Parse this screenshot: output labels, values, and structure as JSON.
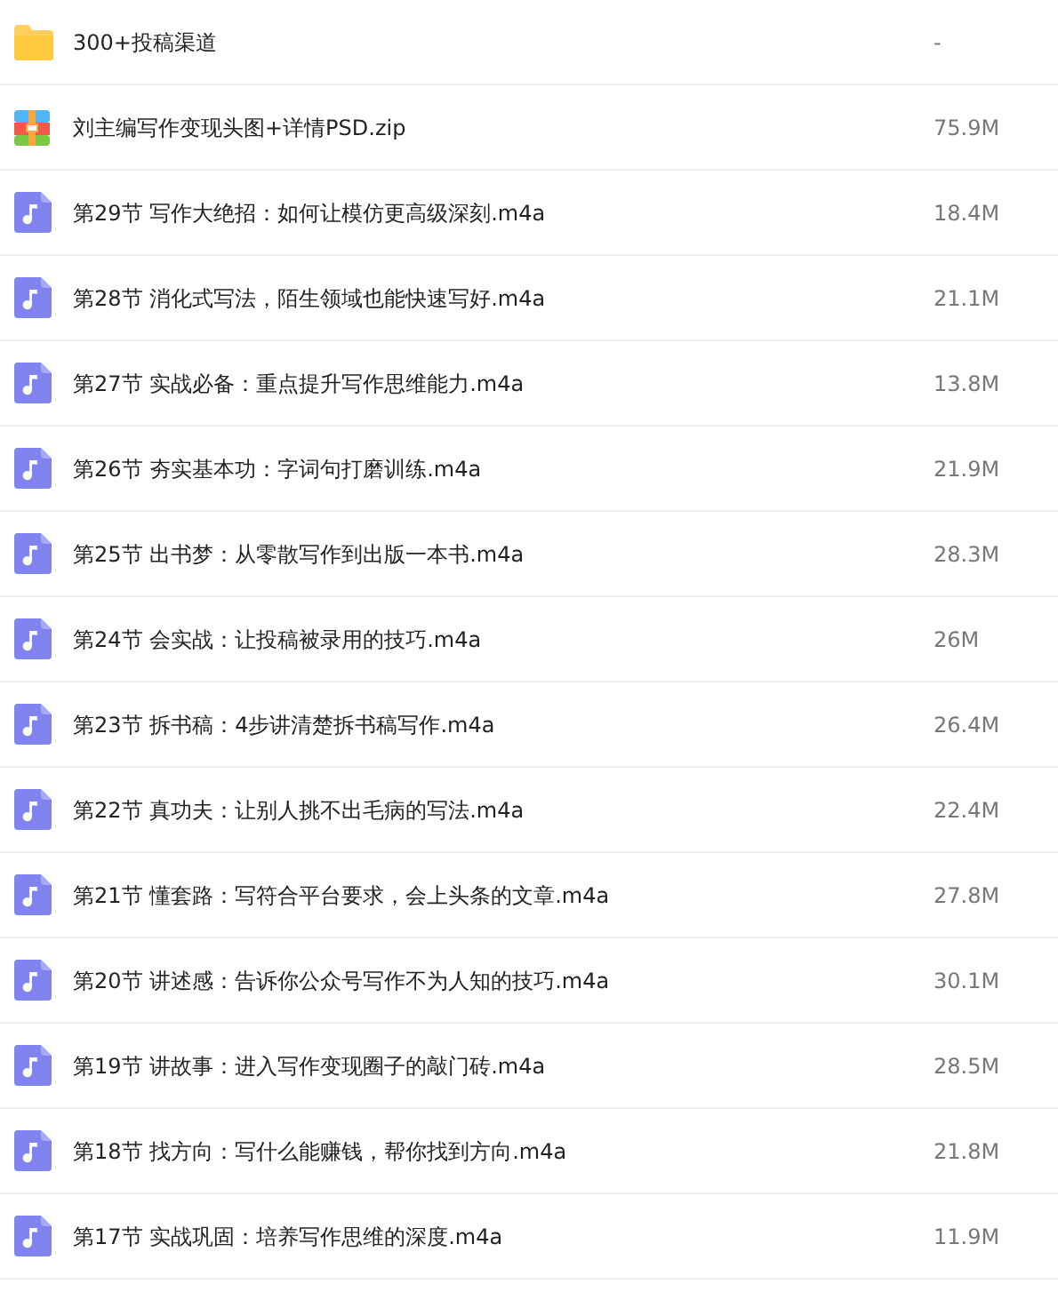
{
  "files": [
    {
      "kind": "folder",
      "name": "300+投稿渠道",
      "size": "-"
    },
    {
      "kind": "zip",
      "name": "刘主编写作变现头图+详情PSD.zip",
      "size": "75.9M"
    },
    {
      "kind": "audio",
      "name": "第29节 写作大绝招：如何让模仿更高级深刻.m4a",
      "size": "18.4M"
    },
    {
      "kind": "audio",
      "name": "第28节 消化式写法，陌生领域也能快速写好.m4a",
      "size": "21.1M"
    },
    {
      "kind": "audio",
      "name": "第27节 实战必备：重点提升写作思维能力.m4a",
      "size": "13.8M"
    },
    {
      "kind": "audio",
      "name": "第26节 夯实基本功：字词句打磨训练.m4a",
      "size": "21.9M"
    },
    {
      "kind": "audio",
      "name": "第25节 出书梦：从零散写作到出版一本书.m4a",
      "size": "28.3M"
    },
    {
      "kind": "audio",
      "name": "第24节 会实战：让投稿被录用的技巧.m4a",
      "size": "26M"
    },
    {
      "kind": "audio",
      "name": "第23节 拆书稿：4步讲清楚拆书稿写作.m4a",
      "size": "26.4M"
    },
    {
      "kind": "audio",
      "name": "第22节 真功夫：让别人挑不出毛病的写法.m4a",
      "size": "22.4M"
    },
    {
      "kind": "audio",
      "name": "第21节 懂套路：写符合平台要求，会上头条的文章.m4a",
      "size": "27.8M"
    },
    {
      "kind": "audio",
      "name": "第20节 讲述感：告诉你公众号写作不为人知的技巧.m4a",
      "size": "30.1M"
    },
    {
      "kind": "audio",
      "name": "第19节 讲故事：进入写作变现圈子的敲门砖.m4a",
      "size": "28.5M"
    },
    {
      "kind": "audio",
      "name": "第18节 找方向：写什么能赚钱，帮你找到方向.m4a",
      "size": "21.8M"
    },
    {
      "kind": "audio",
      "name": "第17节 实战巩固：培养写作思维的深度.m4a",
      "size": "11.9M"
    }
  ]
}
